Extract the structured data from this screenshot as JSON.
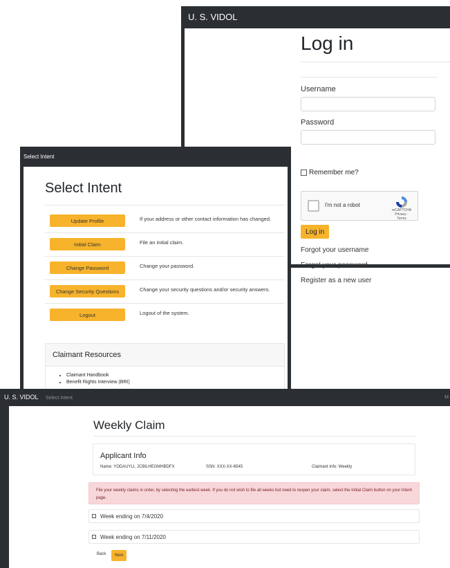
{
  "login": {
    "app_title": "U. S. VIDOL",
    "page_title": "Log in",
    "username_label": "Username",
    "password_label": "Password",
    "remember_label": "Remember me?",
    "recaptcha": {
      "checkbox_label": "I'm not a robot",
      "brand": "reCAPTCHA",
      "links": "Privacy - Terms"
    },
    "login_button": "Log in",
    "links": [
      "Forgot your username",
      "Forgot your password",
      "Register as a new user"
    ]
  },
  "intent": {
    "window_title": "Select Intent",
    "page_title": "Select Intent",
    "options": [
      {
        "button": "Update Profile",
        "description": "If your address or other contact information has changed."
      },
      {
        "button": "Initial Claim",
        "description": "File an initial claim."
      },
      {
        "button": "Change Password",
        "description": "Change your password."
      },
      {
        "button": "Change Security Questions",
        "description": "Change your security questions and/or security answers."
      },
      {
        "button": "Logout",
        "description": "Logout of the system."
      }
    ],
    "resources": {
      "title": "Claimant Resources",
      "items": [
        "Claimant Handbook",
        "Benefit Rights Interview (BRI)"
      ]
    }
  },
  "weekly": {
    "brand": "U. S. VIDOL",
    "breadcrumb": "Select Intent",
    "menu_text": "M",
    "page_title": "Weekly Claim",
    "applicant": {
      "title": "Applicant Info",
      "name": "Name: YODAUYLI, JCBILHEGMHBDFX",
      "ssn": "SSN: XXX-XX-6545",
      "claimant_info": "Claimant Info: Weekly"
    },
    "alert": "File your weekly claims in order, by selecting the earliest week.   If you do not wish to file all weeks but need to reopen your claim, select the Initial Claim button on your Intent page.",
    "weeks": [
      "Week ending on 7/4/2020",
      "Week ending on 7/11/2020"
    ],
    "back_label": "Back",
    "next_label": "Next"
  },
  "colors": {
    "navbar": "#2b2f33",
    "accent_button": "#f7b32b",
    "alert_bg": "#f8d7da",
    "alert_text": "#721c24"
  }
}
